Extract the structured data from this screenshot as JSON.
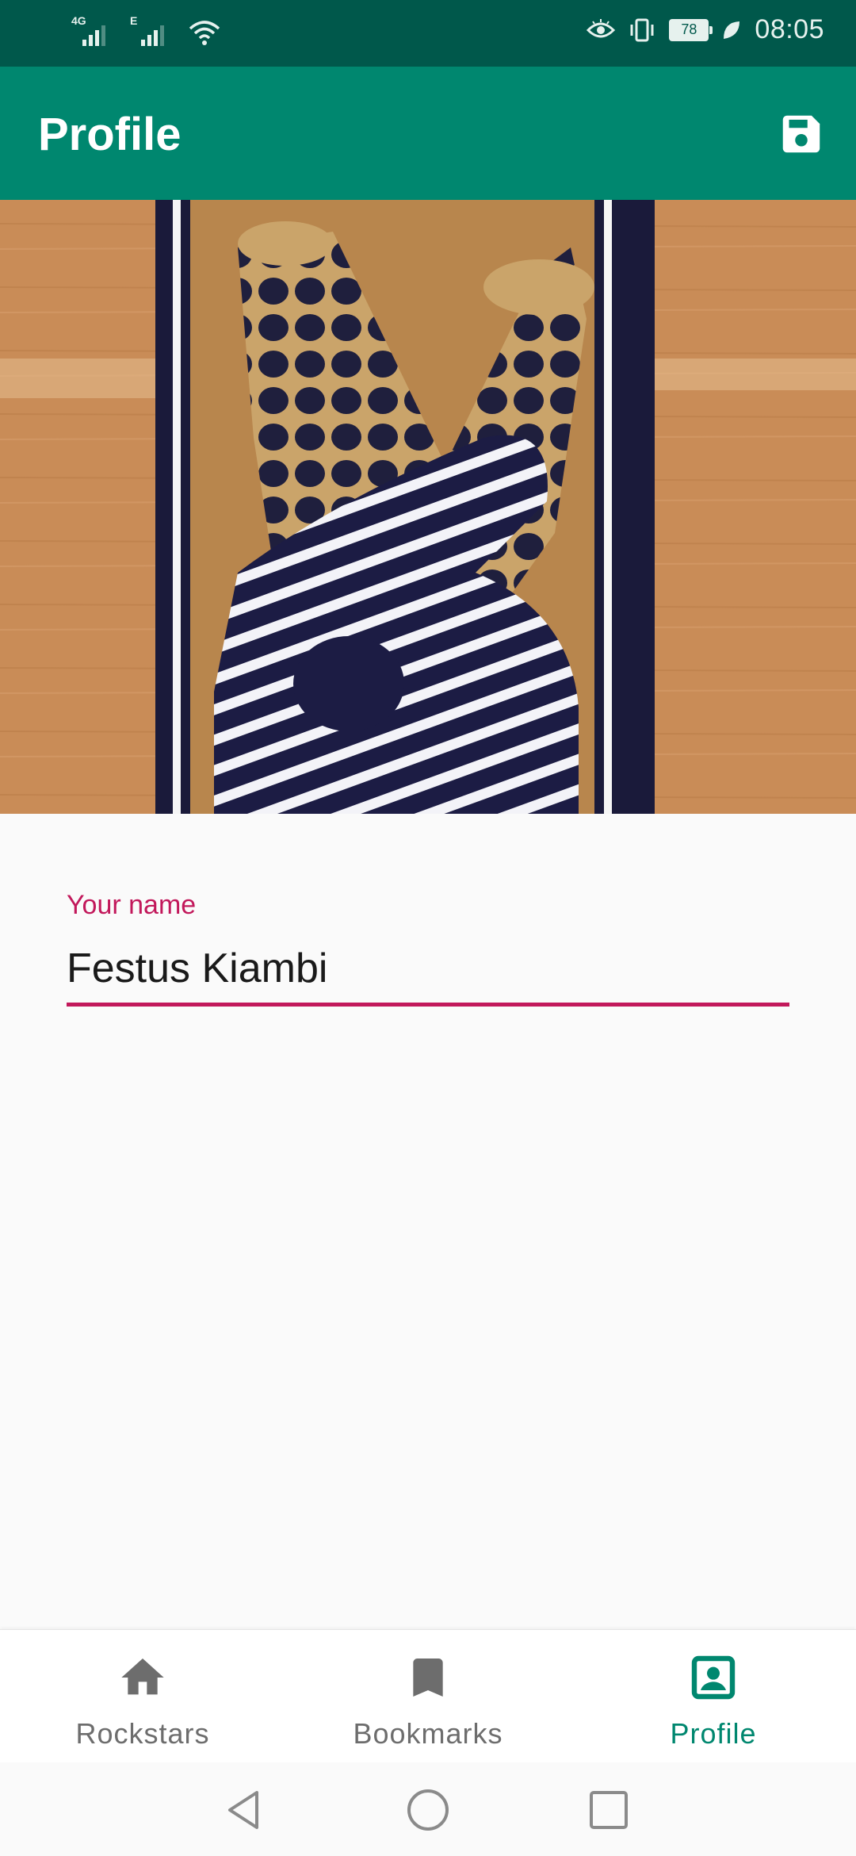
{
  "status_bar": {
    "network_1": "4G",
    "network_2": "E",
    "battery_level": "78",
    "time": "08:05"
  },
  "app_bar": {
    "title": "Profile"
  },
  "profile": {
    "name_label": "Your name",
    "name_value": "Festus Kiambi"
  },
  "bottom_nav": {
    "items": [
      {
        "label": "Rockstars",
        "icon": "home-icon",
        "active": false
      },
      {
        "label": "Bookmarks",
        "icon": "bookmark-icon",
        "active": false
      },
      {
        "label": "Profile",
        "icon": "account-box-icon",
        "active": true
      }
    ]
  },
  "colors": {
    "status_bar": "#00584b",
    "app_bar": "#00876f",
    "accent": "#c2185b",
    "nav_active": "#00876f",
    "nav_inactive": "#6d6d6d"
  }
}
